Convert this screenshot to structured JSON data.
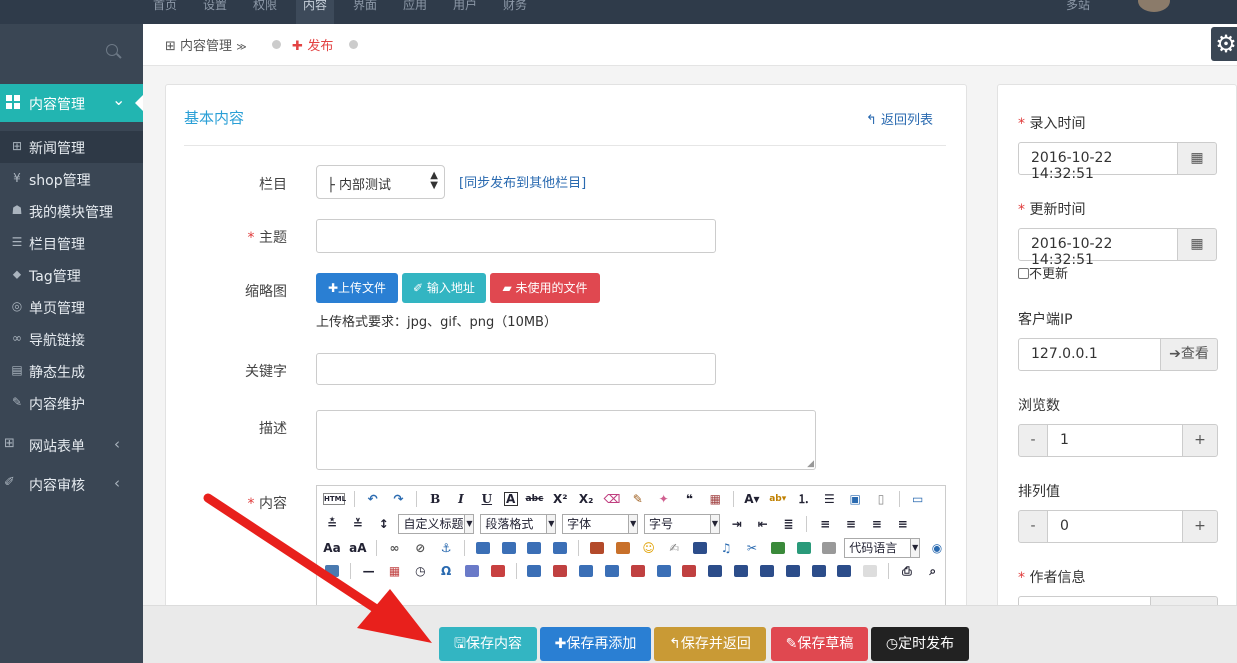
{
  "topnav": {
    "items": [
      "首页",
      "设置",
      "权限",
      "内容",
      "界面",
      "应用",
      "用户",
      "财务"
    ],
    "active_index": 3,
    "site": "多站"
  },
  "sidebar": {
    "active_group": "内容管理",
    "sub_items": [
      {
        "icon": "table-icon",
        "glyph": "⊞",
        "label": "新闻管理"
      },
      {
        "icon": "yen-icon",
        "glyph": "¥",
        "label": "shop管理"
      },
      {
        "icon": "user-icon",
        "glyph": "☗",
        "label": "我的模块管理"
      },
      {
        "icon": "list-icon",
        "glyph": "☰",
        "label": "栏目管理"
      },
      {
        "icon": "tags-icon",
        "glyph": "⬥",
        "label": "Tag管理"
      },
      {
        "icon": "compass-icon",
        "glyph": "◎",
        "label": "单页管理"
      },
      {
        "icon": "link-icon",
        "glyph": "∞",
        "label": "导航链接"
      },
      {
        "icon": "file-icon",
        "glyph": "▤",
        "label": "静态生成"
      },
      {
        "icon": "wrench-icon",
        "glyph": "✎",
        "label": "内容维护"
      }
    ],
    "groups": [
      {
        "icon": "table-icon",
        "glyph": "⊞",
        "label": "网站表单"
      },
      {
        "icon": "edit-icon",
        "glyph": "✐",
        "label": "内容审核"
      }
    ]
  },
  "breadcrumb": {
    "section": "内容管理",
    "section_suffix": "≫",
    "current": "发布"
  },
  "form": {
    "title": "基本内容",
    "back_label": "返回列表",
    "category_label": "栏目",
    "category_value": "├ 内部测试",
    "sync_link": "[同步发布到其他栏目]",
    "subject_label": "主题",
    "thumb_label": "缩略图",
    "upload_label": "上传文件",
    "url_label": "输入地址",
    "unused_label": "未使用的文件",
    "upload_hint": "上传格式要求：jpg、gif、png（10MB）",
    "keywords_label": "关键字",
    "desc_label": "描述",
    "content_label": "内容",
    "editor": {
      "html_label": "HTML",
      "combo_custom": "自定义标题",
      "combo_paragraph": "段落格式",
      "combo_font": "字体",
      "combo_size": "字号",
      "combo_code": "代码语言"
    }
  },
  "side": {
    "entry_time_label": "录入时间",
    "entry_time": "2016-10-22 14:32:51",
    "update_time_label": "更新时间",
    "update_time": "2016-10-22 14:32:51",
    "no_update_label": "不更新",
    "ip_label": "客户端IP",
    "ip_value": "127.0.0.1",
    "view_button": "查看",
    "views_label": "浏览数",
    "views_value": "1",
    "order_label": "排列值",
    "order_value": "0",
    "author_label": "作者信息"
  },
  "bottom_buttons": {
    "save": "保存内容",
    "save_add": "保存再添加",
    "save_return": "保存并返回",
    "save_draft": "保存草稿",
    "schedule": "定时发布"
  },
  "colors": {
    "accent": "#22b5b1",
    "btn_blue": "#2a7fd3",
    "btn_teal": "#33b5c2",
    "btn_red": "#e04850",
    "btn_gold": "#c99a35",
    "btn_dark": "#222222",
    "arrow": "#e8201c"
  }
}
